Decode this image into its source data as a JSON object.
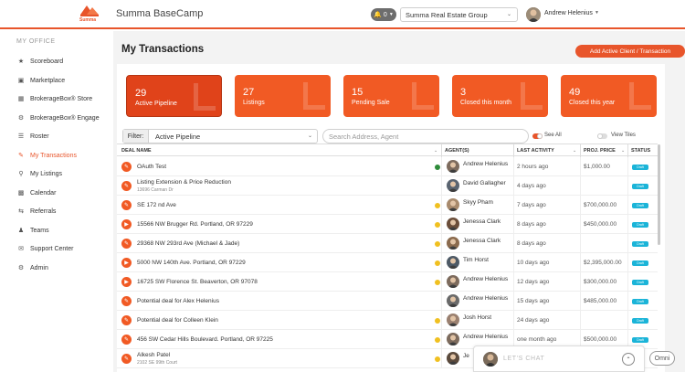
{
  "header": {
    "logo_text": "Summa",
    "app_title": "Summa BaseCamp",
    "notifications_count": "0",
    "organization": "Summa Real Estate Group",
    "user_name": "Andrew Helenius"
  },
  "sidebar": {
    "heading": "MY OFFICE",
    "items": [
      {
        "label": "Scoreboard",
        "icon": "trophy-icon"
      },
      {
        "label": "Marketplace",
        "icon": "cart-icon"
      },
      {
        "label": "BrokerageBox® Store",
        "icon": "store-icon"
      },
      {
        "label": "BrokerageBox® Engage",
        "icon": "gear-icon"
      },
      {
        "label": "Roster",
        "icon": "list-icon"
      },
      {
        "label": "My Transactions",
        "icon": "edit-icon"
      },
      {
        "label": "My Listings",
        "icon": "pin-icon"
      },
      {
        "label": "Calendar",
        "icon": "calendar-icon"
      },
      {
        "label": "Referrals",
        "icon": "referral-icon"
      },
      {
        "label": "Teams",
        "icon": "users-icon"
      },
      {
        "label": "Support Center",
        "icon": "chat-icon"
      },
      {
        "label": "Admin",
        "icon": "cog-icon"
      }
    ],
    "active_label": "My Transactions"
  },
  "main": {
    "title": "My Transactions",
    "add_button": "Add Active Client / Transaction",
    "tiles": [
      {
        "count": "29",
        "label": "Active Pipeline"
      },
      {
        "count": "27",
        "label": "Listings"
      },
      {
        "count": "15",
        "label": "Pending Sale"
      },
      {
        "count": "3",
        "label": "Closed this month"
      },
      {
        "count": "49",
        "label": "Closed this year"
      }
    ],
    "filter_label": "Filter:",
    "filter_value": "Active Pipeline",
    "search_placeholder": "Search Address, Agent",
    "see_all_label": "See All",
    "view_tiles_label": "View Tiles"
  },
  "table": {
    "columns": [
      "DEAL NAME",
      "AGENT(S)",
      "LAST ACTIVITY",
      "PROJ. PRICE",
      "STATUS"
    ],
    "rows": [
      {
        "deal": "OAuth Test",
        "sub": "",
        "dot": "green",
        "agent": "Andrew Helenius",
        "activity": "2 hours ago",
        "price": "$1,000.00",
        "status": "Draft",
        "icon": "edit-icon"
      },
      {
        "deal": "Listing Extension & Price Reduction",
        "sub": "13696 Carman Dr",
        "dot": "",
        "agent": "David Gallagher",
        "activity": "4 days ago",
        "price": "",
        "status": "Draft",
        "icon": "edit-icon"
      },
      {
        "deal": "SE 172 nd Ave",
        "sub": "",
        "dot": "yellow",
        "agent": "Skyy Pham",
        "activity": "7 days ago",
        "price": "$700,000.00",
        "status": "Draft",
        "icon": "edit-icon"
      },
      {
        "deal": "15566 NW Brugger Rd. Portland, OR 97229",
        "sub": "",
        "dot": "yellow",
        "agent": "Jenessa Clark",
        "activity": "8 days ago",
        "price": "$450,000.00",
        "status": "Draft",
        "icon": "play-icon"
      },
      {
        "deal": "29368 NW 293rd Ave (Michael & Jade)",
        "sub": "",
        "dot": "yellow",
        "agent": "Jenessa Clark",
        "activity": "8 days ago",
        "price": "",
        "status": "Draft",
        "icon": "edit-icon"
      },
      {
        "deal": "5000 NW 140th Ave. Portland, OR 97229",
        "sub": "",
        "dot": "yellow",
        "agent": "Tim Horst",
        "activity": "10 days ago",
        "price": "$2,395,000.00",
        "status": "Draft",
        "icon": "play-icon"
      },
      {
        "deal": "16725 SW Florence St. Beaverton, OR 97078",
        "sub": "",
        "dot": "yellow",
        "agent": "Andrew Helenius",
        "activity": "12 days ago",
        "price": "$300,000.00",
        "status": "Draft",
        "icon": "play-icon"
      },
      {
        "deal": "Potential deal for Alex Helenius",
        "sub": "",
        "dot": "",
        "agent": "Andrew Helenius",
        "activity": "15 days ago",
        "price": "$485,000.00",
        "status": "Draft",
        "icon": "edit-icon"
      },
      {
        "deal": "Potential deal for Colleen Klein",
        "sub": "",
        "dot": "yellow",
        "agent": "Josh Horst",
        "activity": "24 days ago",
        "price": "",
        "status": "Draft",
        "icon": "edit-icon"
      },
      {
        "deal": "456 SW Cedar Hills Boulevard. Portland, OR 97225",
        "sub": "",
        "dot": "yellow",
        "agent": "Andrew Helenius",
        "activity": "one month ago",
        "price": "$500,000.00",
        "status": "Draft",
        "icon": "edit-icon"
      },
      {
        "deal": "Alkesh Patel",
        "sub": "2102 SE 99th Court",
        "dot": "yellow",
        "agent": "Je",
        "activity": "",
        "price": "",
        "status": "",
        "icon": "edit-icon"
      }
    ]
  },
  "chat": {
    "label": "LET'S CHAT",
    "omni_label": "Omni"
  },
  "colors": {
    "accent": "#e8552b",
    "tile": "#f15a24",
    "badge": "#1bb4d8",
    "dot_green": "#2e8b3a",
    "dot_yellow": "#f0c020"
  }
}
